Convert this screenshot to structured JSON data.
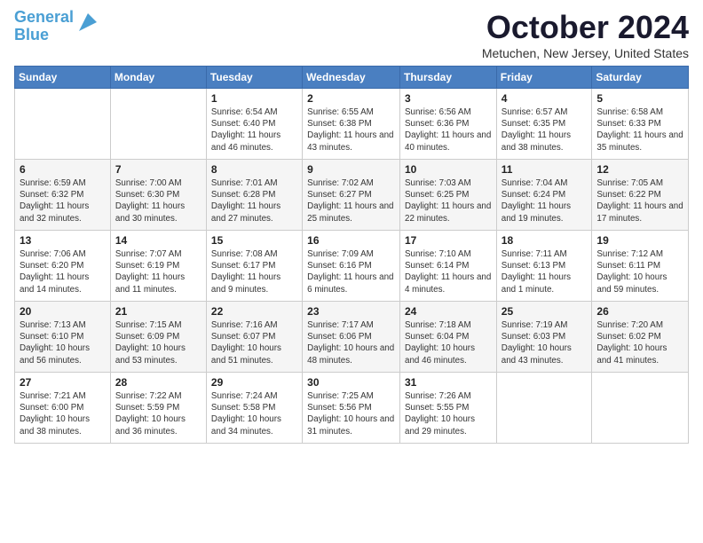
{
  "header": {
    "logo_line1": "General",
    "logo_line2": "Blue",
    "month": "October 2024",
    "location": "Metuchen, New Jersey, United States"
  },
  "weekdays": [
    "Sunday",
    "Monday",
    "Tuesday",
    "Wednesday",
    "Thursday",
    "Friday",
    "Saturday"
  ],
  "weeks": [
    [
      {
        "day": "",
        "sunrise": "",
        "sunset": "",
        "daylight": ""
      },
      {
        "day": "",
        "sunrise": "",
        "sunset": "",
        "daylight": ""
      },
      {
        "day": "1",
        "sunrise": "Sunrise: 6:54 AM",
        "sunset": "Sunset: 6:40 PM",
        "daylight": "Daylight: 11 hours and 46 minutes."
      },
      {
        "day": "2",
        "sunrise": "Sunrise: 6:55 AM",
        "sunset": "Sunset: 6:38 PM",
        "daylight": "Daylight: 11 hours and 43 minutes."
      },
      {
        "day": "3",
        "sunrise": "Sunrise: 6:56 AM",
        "sunset": "Sunset: 6:36 PM",
        "daylight": "Daylight: 11 hours and 40 minutes."
      },
      {
        "day": "4",
        "sunrise": "Sunrise: 6:57 AM",
        "sunset": "Sunset: 6:35 PM",
        "daylight": "Daylight: 11 hours and 38 minutes."
      },
      {
        "day": "5",
        "sunrise": "Sunrise: 6:58 AM",
        "sunset": "Sunset: 6:33 PM",
        "daylight": "Daylight: 11 hours and 35 minutes."
      }
    ],
    [
      {
        "day": "6",
        "sunrise": "Sunrise: 6:59 AM",
        "sunset": "Sunset: 6:32 PM",
        "daylight": "Daylight: 11 hours and 32 minutes."
      },
      {
        "day": "7",
        "sunrise": "Sunrise: 7:00 AM",
        "sunset": "Sunset: 6:30 PM",
        "daylight": "Daylight: 11 hours and 30 minutes."
      },
      {
        "day": "8",
        "sunrise": "Sunrise: 7:01 AM",
        "sunset": "Sunset: 6:28 PM",
        "daylight": "Daylight: 11 hours and 27 minutes."
      },
      {
        "day": "9",
        "sunrise": "Sunrise: 7:02 AM",
        "sunset": "Sunset: 6:27 PM",
        "daylight": "Daylight: 11 hours and 25 minutes."
      },
      {
        "day": "10",
        "sunrise": "Sunrise: 7:03 AM",
        "sunset": "Sunset: 6:25 PM",
        "daylight": "Daylight: 11 hours and 22 minutes."
      },
      {
        "day": "11",
        "sunrise": "Sunrise: 7:04 AM",
        "sunset": "Sunset: 6:24 PM",
        "daylight": "Daylight: 11 hours and 19 minutes."
      },
      {
        "day": "12",
        "sunrise": "Sunrise: 7:05 AM",
        "sunset": "Sunset: 6:22 PM",
        "daylight": "Daylight: 11 hours and 17 minutes."
      }
    ],
    [
      {
        "day": "13",
        "sunrise": "Sunrise: 7:06 AM",
        "sunset": "Sunset: 6:20 PM",
        "daylight": "Daylight: 11 hours and 14 minutes."
      },
      {
        "day": "14",
        "sunrise": "Sunrise: 7:07 AM",
        "sunset": "Sunset: 6:19 PM",
        "daylight": "Daylight: 11 hours and 11 minutes."
      },
      {
        "day": "15",
        "sunrise": "Sunrise: 7:08 AM",
        "sunset": "Sunset: 6:17 PM",
        "daylight": "Daylight: 11 hours and 9 minutes."
      },
      {
        "day": "16",
        "sunrise": "Sunrise: 7:09 AM",
        "sunset": "Sunset: 6:16 PM",
        "daylight": "Daylight: 11 hours and 6 minutes."
      },
      {
        "day": "17",
        "sunrise": "Sunrise: 7:10 AM",
        "sunset": "Sunset: 6:14 PM",
        "daylight": "Daylight: 11 hours and 4 minutes."
      },
      {
        "day": "18",
        "sunrise": "Sunrise: 7:11 AM",
        "sunset": "Sunset: 6:13 PM",
        "daylight": "Daylight: 11 hours and 1 minute."
      },
      {
        "day": "19",
        "sunrise": "Sunrise: 7:12 AM",
        "sunset": "Sunset: 6:11 PM",
        "daylight": "Daylight: 10 hours and 59 minutes."
      }
    ],
    [
      {
        "day": "20",
        "sunrise": "Sunrise: 7:13 AM",
        "sunset": "Sunset: 6:10 PM",
        "daylight": "Daylight: 10 hours and 56 minutes."
      },
      {
        "day": "21",
        "sunrise": "Sunrise: 7:15 AM",
        "sunset": "Sunset: 6:09 PM",
        "daylight": "Daylight: 10 hours and 53 minutes."
      },
      {
        "day": "22",
        "sunrise": "Sunrise: 7:16 AM",
        "sunset": "Sunset: 6:07 PM",
        "daylight": "Daylight: 10 hours and 51 minutes."
      },
      {
        "day": "23",
        "sunrise": "Sunrise: 7:17 AM",
        "sunset": "Sunset: 6:06 PM",
        "daylight": "Daylight: 10 hours and 48 minutes."
      },
      {
        "day": "24",
        "sunrise": "Sunrise: 7:18 AM",
        "sunset": "Sunset: 6:04 PM",
        "daylight": "Daylight: 10 hours and 46 minutes."
      },
      {
        "day": "25",
        "sunrise": "Sunrise: 7:19 AM",
        "sunset": "Sunset: 6:03 PM",
        "daylight": "Daylight: 10 hours and 43 minutes."
      },
      {
        "day": "26",
        "sunrise": "Sunrise: 7:20 AM",
        "sunset": "Sunset: 6:02 PM",
        "daylight": "Daylight: 10 hours and 41 minutes."
      }
    ],
    [
      {
        "day": "27",
        "sunrise": "Sunrise: 7:21 AM",
        "sunset": "Sunset: 6:00 PM",
        "daylight": "Daylight: 10 hours and 38 minutes."
      },
      {
        "day": "28",
        "sunrise": "Sunrise: 7:22 AM",
        "sunset": "Sunset: 5:59 PM",
        "daylight": "Daylight: 10 hours and 36 minutes."
      },
      {
        "day": "29",
        "sunrise": "Sunrise: 7:24 AM",
        "sunset": "Sunset: 5:58 PM",
        "daylight": "Daylight: 10 hours and 34 minutes."
      },
      {
        "day": "30",
        "sunrise": "Sunrise: 7:25 AM",
        "sunset": "Sunset: 5:56 PM",
        "daylight": "Daylight: 10 hours and 31 minutes."
      },
      {
        "day": "31",
        "sunrise": "Sunrise: 7:26 AM",
        "sunset": "Sunset: 5:55 PM",
        "daylight": "Daylight: 10 hours and 29 minutes."
      },
      {
        "day": "",
        "sunrise": "",
        "sunset": "",
        "daylight": ""
      },
      {
        "day": "",
        "sunrise": "",
        "sunset": "",
        "daylight": ""
      }
    ]
  ]
}
